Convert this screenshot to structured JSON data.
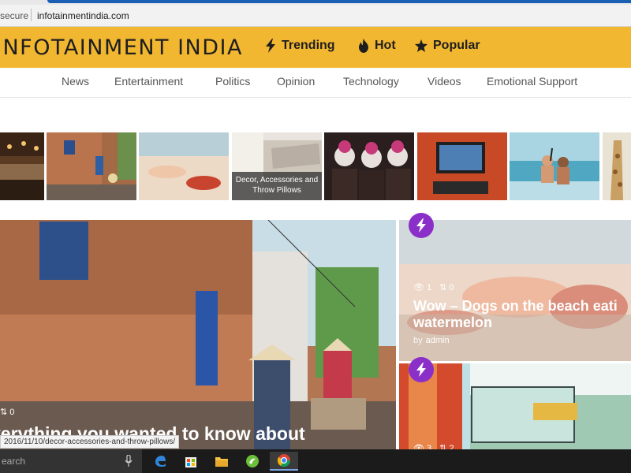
{
  "browser": {
    "secure_label": "secure",
    "url": "infotainmentindia.com"
  },
  "site": {
    "brand": "INFOTAINMENT INDIA",
    "top_nav": [
      {
        "label": "Trending",
        "icon": "bolt-icon"
      },
      {
        "label": "Hot",
        "icon": "flame-icon"
      },
      {
        "label": "Popular",
        "icon": "star-icon"
      }
    ],
    "categories": [
      "News",
      "Entertainment",
      "Politics",
      "Opinion",
      "Technology",
      "Videos",
      "Emotional Support"
    ]
  },
  "thumbnails": {
    "decor_caption": "Decor, Accessories and Throw Pillows"
  },
  "feature": {
    "title": "verything you wanted to know about",
    "shares": "0"
  },
  "cards": [
    {
      "views": "1",
      "shares": "0",
      "title_line1": "Wow – Dogs on the beach eati",
      "title_line2": "watermelon",
      "by": "by",
      "author": "admin"
    },
    {
      "views": "3",
      "shares": "2"
    }
  ],
  "status_bar": {
    "url": "2016/11/10/decor-accessories-and-throw-pillows/"
  },
  "taskbar": {
    "search_placeholder": "earch",
    "apps": [
      "edge-icon",
      "store-icon",
      "file-explorer-icon",
      "app-icon",
      "chrome-icon"
    ]
  },
  "colors": {
    "header": "#f2b731",
    "badge": "#8b2fc9",
    "taskbar": "#1b1b1b"
  }
}
